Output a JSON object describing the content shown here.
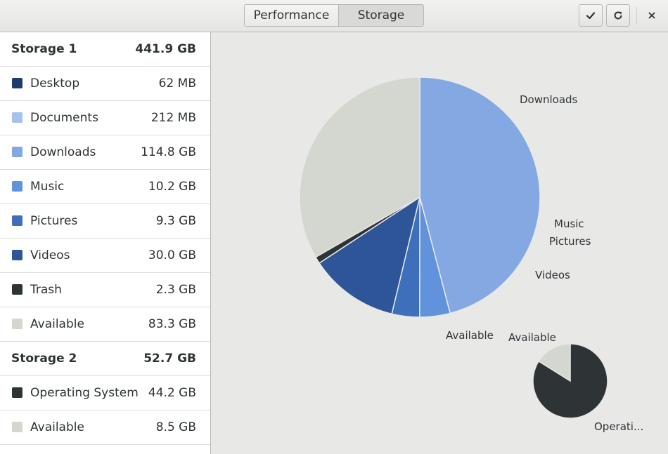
{
  "header": {
    "tabs": [
      {
        "label": "Performance",
        "active": false
      },
      {
        "label": "Storage",
        "active": true
      }
    ],
    "buttons": {
      "check": "check-icon",
      "refresh": "refresh-icon",
      "close": "close-icon"
    }
  },
  "sidebar": {
    "rows": [
      {
        "type": "header",
        "label": "Storage 1",
        "value": "441.9 GB"
      },
      {
        "type": "item",
        "label": "Desktop",
        "value": "62 MB",
        "color": "#1c3d6e"
      },
      {
        "type": "item",
        "label": "Documents",
        "value": "212 MB",
        "color": "#a5c2ec"
      },
      {
        "type": "item",
        "label": "Downloads",
        "value": "114.8 GB",
        "color": "#84a8e2"
      },
      {
        "type": "item",
        "label": "Music",
        "value": "10.2 GB",
        "color": "#6093dc"
      },
      {
        "type": "item",
        "label": "Pictures",
        "value": "9.3 GB",
        "color": "#3d6fba"
      },
      {
        "type": "item",
        "label": "Videos",
        "value": "30.0 GB",
        "color": "#2d5597"
      },
      {
        "type": "item",
        "label": "Trash",
        "value": "2.3 GB",
        "color": "#2e3436"
      },
      {
        "type": "item",
        "label": "Available",
        "value": "83.3 GB",
        "color": "#d3d7cf"
      },
      {
        "type": "header",
        "label": "Storage 2",
        "value": "52.7 GB"
      },
      {
        "type": "item",
        "label": "Operating System",
        "value": "44.2 GB",
        "color": "#2e3436"
      },
      {
        "type": "item",
        "label": "Available",
        "value": "8.5 GB",
        "color": "#d3d7cf"
      }
    ]
  },
  "chart_data": [
    {
      "type": "pie",
      "labels": [
        "Downloads",
        "Music",
        "Pictures",
        "Videos",
        "Available"
      ],
      "values": [
        114.8,
        10.2,
        9.3,
        30.0,
        2.3,
        83.3
      ],
      "colors": [
        "#84a8e2",
        "#6093dc",
        "#3d6fba",
        "#2d5597",
        "#2e3436",
        "#d3d7cf"
      ]
    },
    {
      "type": "pie",
      "labels": [
        "Available",
        "Operati..."
      ],
      "values": [
        8.5,
        44.2
      ],
      "colors": [
        "#d3d7cf",
        "#2e3436"
      ]
    }
  ]
}
